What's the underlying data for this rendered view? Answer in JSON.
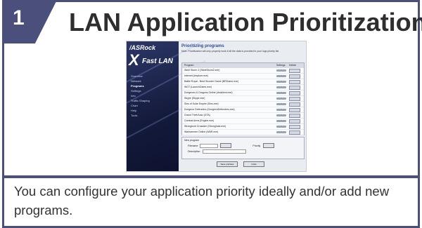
{
  "step": {
    "number": "1"
  },
  "title": "LAN Application Prioritization",
  "description": "You can configure your application priority ideally and/or add new programs.",
  "screenshot": {
    "brand": "/ASRock",
    "logo_x": "X",
    "logo_text": "Fast LAN",
    "nav_items": [
      "Overview",
      "Network",
      "Programs",
      "Settings",
      "Info",
      "Traffic Shaping",
      "Chart",
      "Help",
      "Tools"
    ],
    "main_title": "Prioritizing programs",
    "main_note": "Note: Prioritization will only properly work if all the data is provided in your logs priority list.",
    "table_headers": [
      "Program",
      "Settings",
      "Delete"
    ],
    "rows": [
      "Steel Storm 2 (SteelStorm2.exe)",
      "Internet (iexplore.exe)",
      "Battle Royal - Best Shooter Game (BRGame.exe)",
      "WOT (LaunchGame.exe)",
      "Dungeons & Dragons Online (dndclient.exe)",
      "Skype (Skype.exe)",
      "Sins of Solar Empire (Sins.exe)",
      "Dungeon Defenders (DungeonDefenders.exe)",
      "Grand Theft Auto (GTA)",
      "Combat Arms (Engine.exe)",
      "Stronghold Crusader (Stronghold.exe)",
      "Warhammer Online (WAR.exe)"
    ],
    "new_program_label": "New program",
    "filename_label": "Filename",
    "description_label": "Description",
    "search_label": "Search",
    "add_label": "Add",
    "priority_label": "Priority",
    "btn_left": "Save priorities",
    "btn_right": "Undo"
  },
  "colors": {
    "accent": "#4a4f7c"
  }
}
